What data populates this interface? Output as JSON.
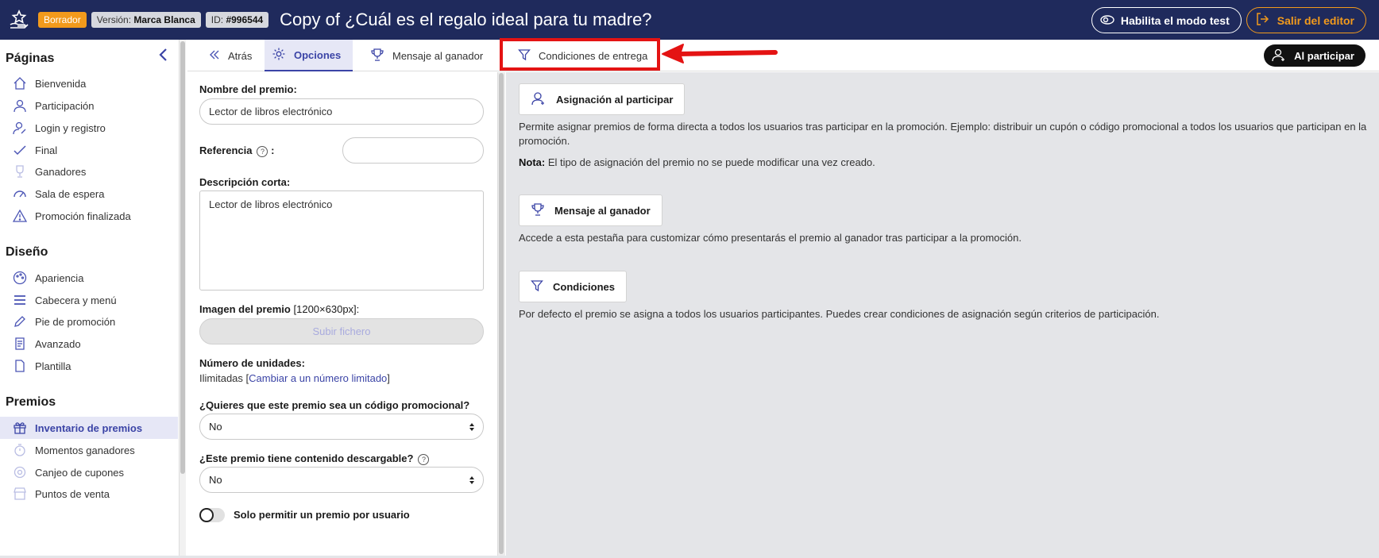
{
  "header": {
    "status_badge": "Borrador",
    "version_label": "Versión:",
    "version_value": "Marca Blanca",
    "id_label": "ID:",
    "id_value": "#996544",
    "title": "Copy of ¿Cuál es el regalo ideal para tu madre?",
    "test_mode_label": "Habilita el modo test",
    "exit_label": "Salir del editor"
  },
  "sidebar": {
    "sections": [
      {
        "title": "Páginas",
        "items": [
          {
            "label": "Bienvenida",
            "icon": "home-icon"
          },
          {
            "label": "Participación",
            "icon": "user-icon"
          },
          {
            "label": "Login y registro",
            "icon": "user-edit-icon"
          },
          {
            "label": "Final",
            "icon": "check-icon"
          },
          {
            "label": "Ganadores",
            "icon": "trophy-icon"
          },
          {
            "label": "Sala de espera",
            "icon": "gauge-icon"
          },
          {
            "label": "Promoción finalizada",
            "icon": "warning-icon"
          }
        ]
      },
      {
        "title": "Diseño",
        "items": [
          {
            "label": "Apariencia",
            "icon": "palette-icon"
          },
          {
            "label": "Cabecera y menú",
            "icon": "menu-icon"
          },
          {
            "label": "Pie de promoción",
            "icon": "pen-icon"
          },
          {
            "label": "Avanzado",
            "icon": "scroll-icon"
          },
          {
            "label": "Plantilla",
            "icon": "file-icon"
          }
        ]
      },
      {
        "title": "Premios",
        "items": [
          {
            "label": "Inventario de premios",
            "icon": "gift-icon",
            "active": true
          },
          {
            "label": "Momentos ganadores",
            "icon": "stopwatch-icon"
          },
          {
            "label": "Canjeo de cupones",
            "icon": "coupon-icon"
          },
          {
            "label": "Puntos de venta",
            "icon": "store-icon"
          }
        ]
      }
    ]
  },
  "tabs": {
    "back": "Atrás",
    "options": "Opciones",
    "winner_message": "Mensaje al ganador",
    "delivery_conditions": "Condiciones de entrega",
    "on_participate": "Al participar"
  },
  "form": {
    "prize_name_label": "Nombre del premio:",
    "prize_name_value": "Lector de libros electrónico",
    "reference_label": "Referencia",
    "reference_colon": ":",
    "reference_value": "",
    "short_desc_label": "Descripción corta:",
    "short_desc_value": "Lector de libros electrónico",
    "image_label": "Imagen del premio",
    "image_size": "[1200×630px]",
    "image_colon": ":",
    "upload_label": "Subir fichero",
    "units_label": "Número de unidades:",
    "units_value": "Ilimitadas",
    "units_link": "Cambiar a un número limitado",
    "promo_code_label": "¿Quieres que este premio sea un código promocional?",
    "promo_code_value": "No",
    "download_label": "¿Este premio tiene contenido descargable?",
    "download_value": "No",
    "one_per_user_label": "Solo permitir un premio por usuario",
    "one_per_user_on": false
  },
  "content": {
    "assign_button": "Asignación al participar",
    "assign_text": "Permite asignar premios de forma directa a todos los usuarios tras participar en la promoción. Ejemplo: distribuir un cupón o código promocional a todos los usuarios que participan en la promoción.",
    "note_label": "Nota:",
    "note_text": "El tipo de asignación del premio no se puede modificar una vez creado.",
    "winner_button": "Mensaje al ganador",
    "winner_text": "Accede a esta pestaña para customizar cómo presentarás el premio al ganador tras participar a la promoción.",
    "conditions_button": "Condiciones",
    "conditions_text": "Por defecto el premio se asigna a todos los usuarios participantes. Puedes crear condiciones de asignación según criterios de participación."
  },
  "colors": {
    "header_bg": "#1f2a5c",
    "accent": "#3b44a6",
    "draft_badge": "#f29a1c",
    "highlight": "#e41313"
  }
}
